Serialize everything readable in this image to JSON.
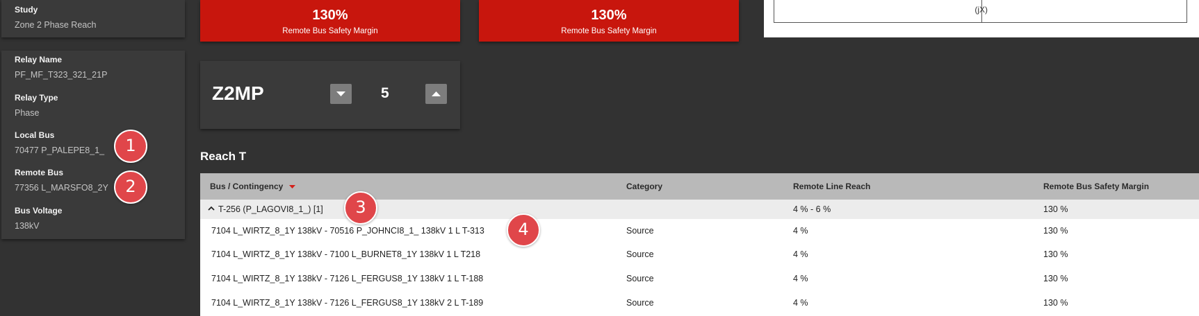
{
  "left_panel": {
    "study": {
      "label": "Study",
      "value": "Zone 2 Phase Reach"
    },
    "relay_name": {
      "label": "Relay Name",
      "value": "PF_MF_T323_321_21P"
    },
    "relay_type": {
      "label": "Relay Type",
      "value": "Phase"
    },
    "local_bus": {
      "label": "Local Bus",
      "value": "70477 P_PALEPE8_1_"
    },
    "remote_bus": {
      "label": "Remote Bus",
      "value": "77356 L_MARSFO8_2Y"
    },
    "bus_voltage": {
      "label": "Bus Voltage",
      "value": "138kV"
    }
  },
  "cards": [
    {
      "value": "130%",
      "label": "Remote Bus Safety Margin"
    },
    {
      "value": "130%",
      "label": "Remote Bus Safety Margin"
    }
  ],
  "chart": {
    "axis_label": "(jX)"
  },
  "zone": {
    "name": "Z2MP",
    "step_value": "5",
    "decrement_icon": "triangle-down-icon",
    "increment_icon": "triangle-up-icon"
  },
  "section_title": "Reach T",
  "table": {
    "headers": [
      "Bus / Contingency",
      "Category",
      "Remote Line Reach",
      "Remote Bus Safety Margin"
    ],
    "group": {
      "label": "T-256 (P_LAGOVI8_1_) [1]",
      "reach": "4 % - 6 %",
      "margin": "130 %",
      "toggle_icon": "chevron-up-icon"
    },
    "rows": [
      {
        "contingency": "7104 L_WIRTZ_8_1Y 138kV - 70516 P_JOHNCI8_1_ 138kV 1 L T-313",
        "category": "Source",
        "reach": "4 %",
        "margin": "130 %"
      },
      {
        "contingency": "7104 L_WIRTZ_8_1Y 138kV - 7100 L_BURNET8_1Y 138kV 1 L T218",
        "category": "Source",
        "reach": "4 %",
        "margin": "130 %"
      },
      {
        "contingency": "7104 L_WIRTZ_8_1Y 138kV - 7126 L_FERGUS8_1Y 138kV 1 L T-188",
        "category": "Source",
        "reach": "4 %",
        "margin": "130 %"
      },
      {
        "contingency": "7104 L_WIRTZ_8_1Y 138kV - 7126 L_FERGUS8_1Y 138kV 2 L T-189",
        "category": "Source",
        "reach": "4 %",
        "margin": "130 %"
      }
    ]
  },
  "markers": [
    "1",
    "2",
    "3",
    "4"
  ],
  "colors": {
    "accent_red": "#c8160d",
    "marker_red": "#e0464a",
    "background": "#323232",
    "panel": "#3a3a3a"
  }
}
